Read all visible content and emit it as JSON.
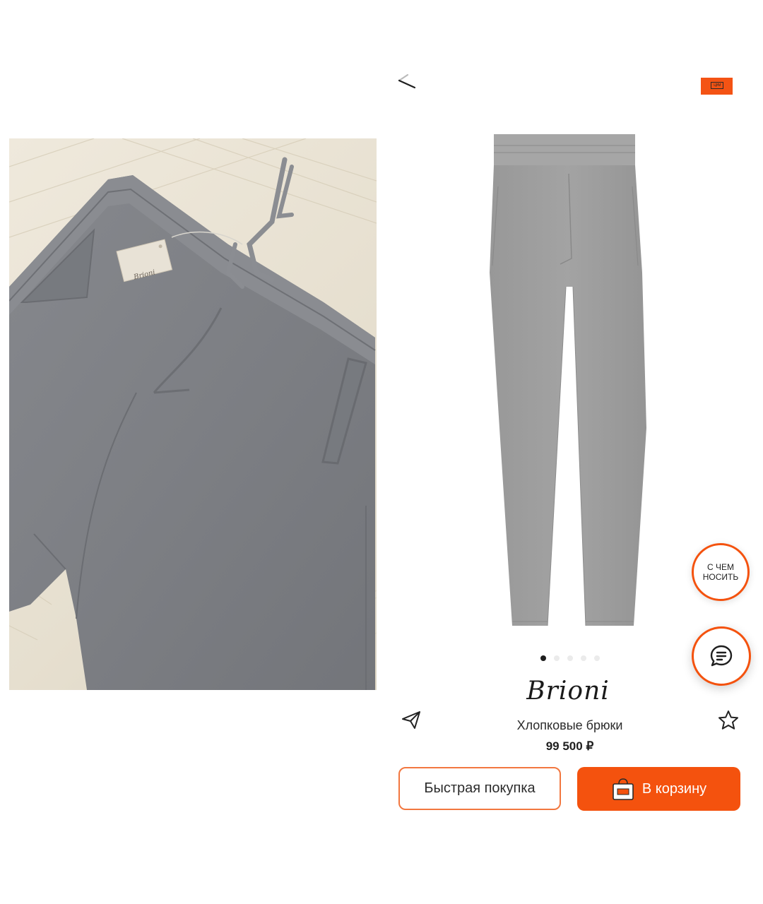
{
  "header": {
    "back_icon": "back-arrow-icon",
    "bag_icon": "shopping-bag-icon",
    "bag_badge_text": "ЦУМ",
    "accent_color": "#f45314"
  },
  "photo": {
    "tag_brand": "Brioni"
  },
  "product": {
    "brand": "Brioni",
    "title": "Хлопковые брюки",
    "price": "99 500 ₽",
    "gallery_total": 5,
    "gallery_active_index": 0
  },
  "actions": {
    "quick_buy_label": "Быстрая покупка",
    "add_to_cart_label": "В корзину",
    "share_icon": "paper-plane-icon",
    "favorite_icon": "star-icon",
    "cart_icon": "shopping-bag-icon"
  },
  "floating": {
    "what_to_wear_line1": "С ЧЕМ",
    "what_to_wear_line2": "НОСИТЬ",
    "chat_icon": "chat-bubble-icon"
  }
}
